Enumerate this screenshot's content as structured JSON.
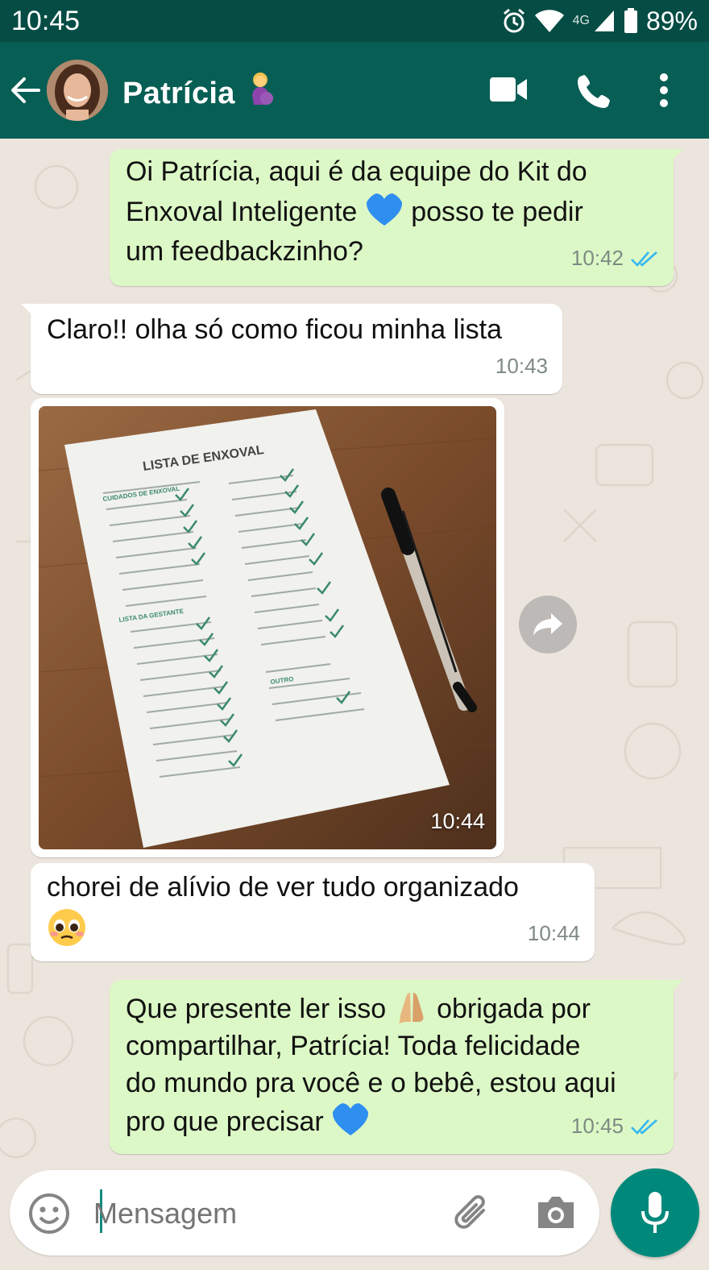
{
  "status_bar": {
    "time": "10:45",
    "network": "4G",
    "battery": "89%"
  },
  "header": {
    "contact_name": "Patrícia",
    "colors": {
      "header": "#075e54",
      "status": "#054d44"
    }
  },
  "messages": [
    {
      "direction": "outgoing",
      "line1": "Oi Patrícia, aqui é da equipe do Kit do",
      "line2a": "Enxoval Inteligente",
      "line2b": "posso te pedir",
      "line3": "um feedbackzinho?",
      "time": "10:42",
      "status": "read"
    },
    {
      "direction": "incoming",
      "text": "Claro!! olha só como ficou minha lista",
      "time": "10:43"
    },
    {
      "direction": "incoming",
      "type": "image",
      "photo": {
        "title": "LISTA DE ENXOVAL",
        "section1": "CUIDADOS DE ENXOVAL",
        "section2": "LISTA DA GESTANTE",
        "section3": "OUTRO"
      },
      "time": "10:44"
    },
    {
      "direction": "incoming",
      "text": "chorei de alívio de ver tudo organizado",
      "time": "10:44"
    },
    {
      "direction": "outgoing",
      "line1a": "Que presente ler isso",
      "line1b": "obrigada por",
      "line2": "compartilhar, Patrícia! Toda felicidade",
      "line3": "do mundo pra você e o bebê, estou aqui",
      "line4": "pro que precisar",
      "time": "10:45",
      "status": "read"
    }
  ],
  "composer": {
    "placeholder": "Mensagem"
  },
  "colors": {
    "outgoing_bubble": "#dcf8c6",
    "incoming_bubble": "#ffffff",
    "read_ticks": "#34b7f1",
    "accent": "#00897b"
  }
}
